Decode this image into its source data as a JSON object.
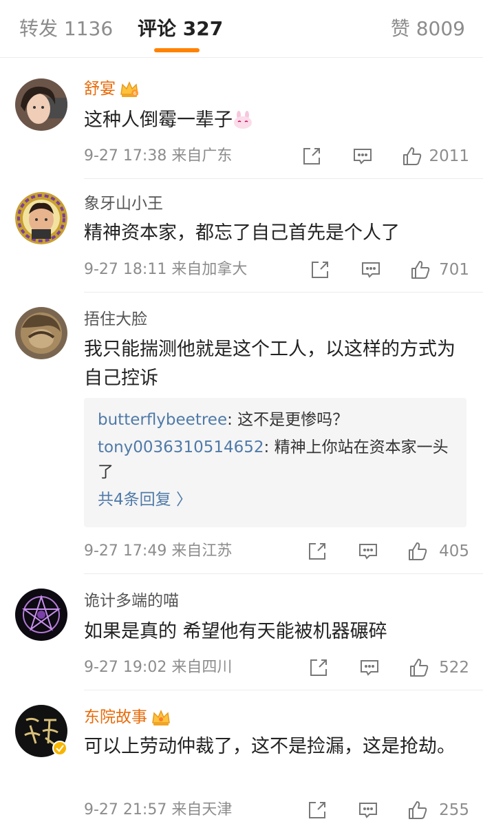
{
  "tabs": {
    "repost": "转发 1136",
    "comments": "评论 327",
    "likes": "赞 8009"
  },
  "colors": {
    "accent": "#ff8200",
    "vip_name": "#e86b0a",
    "link": "#4f7aa8"
  },
  "comments": [
    {
      "username": "舒宴",
      "vip": true,
      "text": "这种人倒霉一辈子",
      "emoji": "bunny-emoji",
      "time": "9-27 17:38",
      "location": "来自广东",
      "likes": "2011"
    },
    {
      "username": "象牙山小王",
      "vip": false,
      "text": "精神资本家，都忘了自己首先是个人了",
      "time": "9-27 18:11",
      "location": "来自加拿大",
      "likes": "701"
    },
    {
      "username": "捂住大脸",
      "vip": false,
      "text": "我只能揣测他就是这个工人，以这样的方式为自己控诉",
      "time": "9-27 17:49",
      "location": "来自江苏",
      "likes": "405",
      "replies": [
        {
          "name": "butterflybeetree",
          "text": ": 这不是更惨吗？"
        },
        {
          "name": "tony0036310514652",
          "text": ": 精神上你站在资本家一头了"
        }
      ],
      "more_replies": "共4条回复 〉"
    },
    {
      "username": "诡计多端的喵",
      "vip": false,
      "text": "如果是真的 希望他有天能被机器碾碎",
      "time": "9-27 19:02",
      "location": "来自四川",
      "likes": "522"
    },
    {
      "username": "东院故事",
      "vip": true,
      "text": "可以上劳动仲裁了，这不是捡漏，这是抢劫。",
      "time": "9-27 21:57",
      "location": "来自天津",
      "likes": "255"
    }
  ]
}
